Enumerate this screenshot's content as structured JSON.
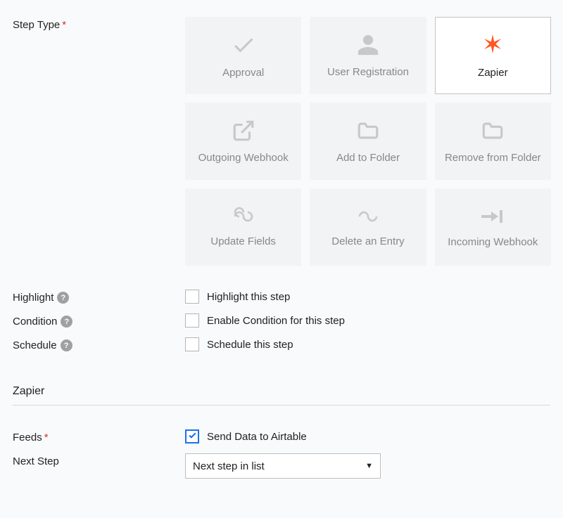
{
  "labels": {
    "step_type": "Step Type",
    "highlight": "Highlight",
    "condition": "Condition",
    "schedule": "Schedule",
    "feeds": "Feeds",
    "next_step": "Next Step"
  },
  "section": {
    "zapier": "Zapier"
  },
  "step_types": {
    "approval": "Approval",
    "user_registration": "User Registration",
    "zapier": "Zapier",
    "outgoing_webhook": "Outgoing Webhook",
    "add_to_folder": "Add to Folder",
    "remove_from_folder": "Remove from Folder",
    "update_fields": "Update Fields",
    "delete_entry": "Delete an Entry",
    "incoming_webhook": "Incoming Webhook"
  },
  "options": {
    "highlight": "Highlight this step",
    "condition": "Enable Condition for this step",
    "schedule": "Schedule this step"
  },
  "feeds_option": "Send Data to Airtable",
  "next_step_value": "Next step in list",
  "checked": {
    "highlight": false,
    "condition": false,
    "schedule": false,
    "feeds": true
  },
  "selected_step_type": "zapier"
}
